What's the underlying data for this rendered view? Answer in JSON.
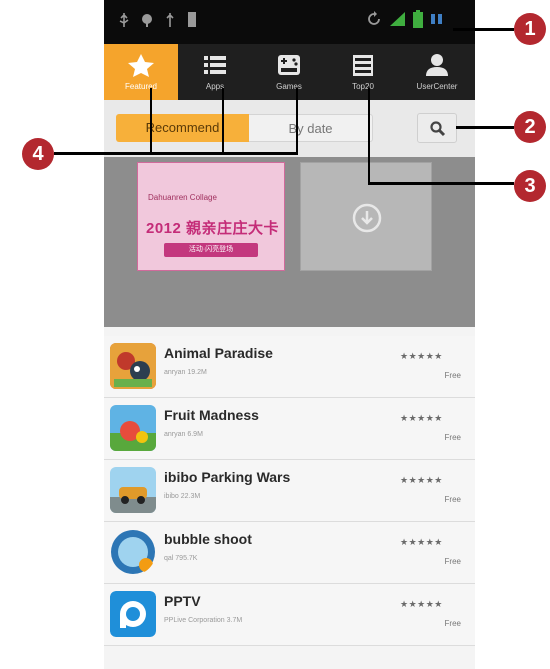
{
  "status_bar": {
    "left_icons": [
      "usb-icon",
      "android-debug-icon",
      "usb-icon",
      "sd-card-icon"
    ],
    "right_icons": [
      "sync-icon",
      "signal-icon",
      "battery-icon",
      "clock-icon"
    ]
  },
  "tabs": [
    {
      "label": "Featured",
      "icon": "star-icon",
      "active": true
    },
    {
      "label": "Apps",
      "icon": "list-icon",
      "active": false
    },
    {
      "label": "Games",
      "icon": "gamepad-icon",
      "active": false
    },
    {
      "label": "Top20",
      "icon": "top-chart-icon",
      "active": false
    },
    {
      "label": "UserCenter",
      "icon": "user-icon",
      "active": false
    }
  ],
  "filter": {
    "recommend_label": "Recommend",
    "by_date_label": "By date",
    "search_icon": "search-icon"
  },
  "banner": {
    "promo_top": "Dahuanren  Collage",
    "promo_main": "2012 親亲庄庄大卡",
    "promo_sub": "活动·闪亮登场",
    "placeholder_icon": "download-icon"
  },
  "apps": [
    {
      "name": "Animal Paradise",
      "meta": "anryan   19.2M",
      "rating": "★★★★★",
      "price": "Free",
      "icon_color": "#d9542c"
    },
    {
      "name": "Fruit Madness",
      "meta": "anryan   6.9M",
      "rating": "★★★★★",
      "price": "Free",
      "icon_color": "#58a83c"
    },
    {
      "name": "ibibo Parking Wars",
      "meta": "ibibo   22.3M",
      "rating": "★★★★★",
      "price": "Free",
      "icon_color": "#e09a2a"
    },
    {
      "name": "bubble shoot",
      "meta": "qal   795.7K",
      "rating": "★★★★★",
      "price": "Free",
      "icon_color": "#2d76b5"
    },
    {
      "name": "PPTV",
      "meta": "PPLive Corporation   3.7M",
      "rating": "★★★★★",
      "price": "Free",
      "icon_color": "#1f8fd9"
    }
  ],
  "callouts": [
    "1",
    "2",
    "3",
    "4"
  ],
  "colors": {
    "accent": "#f5a42c",
    "callout": "#b3282f"
  }
}
